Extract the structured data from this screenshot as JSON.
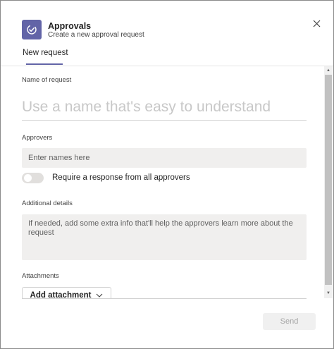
{
  "header": {
    "title": "Approvals",
    "subtitle": "Create a new approval request",
    "app_icon": "approval-check-icon",
    "close_icon": "close-icon",
    "accent_color": "#6264a7"
  },
  "tabs": [
    {
      "label": "New request",
      "selected": true
    }
  ],
  "form": {
    "name": {
      "label": "Name of request",
      "placeholder": "Use a name that's easy to understand",
      "value": ""
    },
    "approvers": {
      "label": "Approvers",
      "placeholder": "Enter names here",
      "value": ""
    },
    "require_all": {
      "label": "Require a response from all approvers",
      "checked": false
    },
    "details": {
      "label": "Additional details",
      "placeholder": "If needed, add some extra info that'll help the approvers learn more about the request",
      "value": ""
    },
    "attachments": {
      "label": "Attachments",
      "button_label": "Add attachment",
      "button_icon": "chevron-down-icon"
    }
  },
  "footer": {
    "send_label": "Send",
    "send_disabled": true
  }
}
